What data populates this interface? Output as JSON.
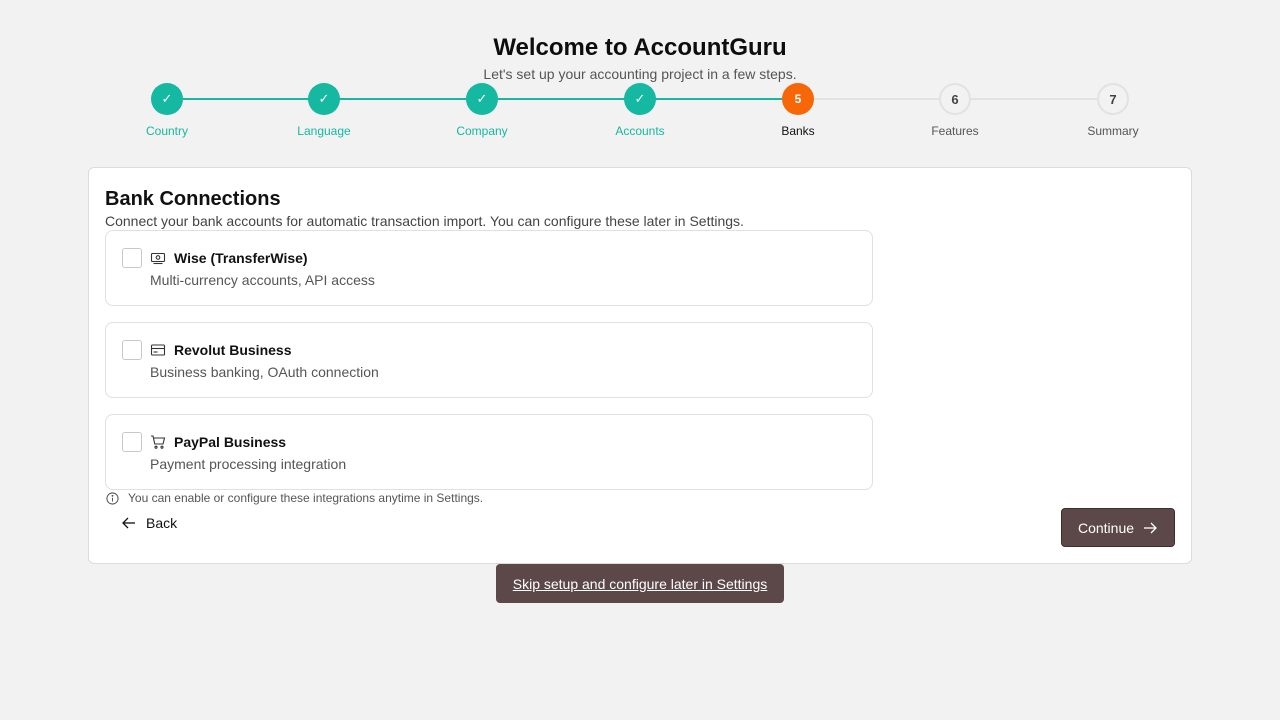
{
  "header": {
    "title": "Welcome to AccountGuru",
    "subtitle": "Let's set up your accounting project in a few steps."
  },
  "steps": [
    {
      "label": "Country",
      "status": "done",
      "marker": "✓"
    },
    {
      "label": "Language",
      "status": "done",
      "marker": "✓"
    },
    {
      "label": "Company",
      "status": "done",
      "marker": "✓"
    },
    {
      "label": "Accounts",
      "status": "done",
      "marker": "✓"
    },
    {
      "label": "Banks",
      "status": "active",
      "marker": "5"
    },
    {
      "label": "Features",
      "status": "todo",
      "marker": "6"
    },
    {
      "label": "Summary",
      "status": "todo",
      "marker": "7"
    }
  ],
  "card": {
    "title": "Bank Connections",
    "description": "Connect your bank accounts for automatic transaction import. You can configure these later in Settings.",
    "banks": [
      {
        "name": "Wise (TransferWise)",
        "description": "Multi-currency accounts, API access",
        "icon": "banknote-icon",
        "checked": false
      },
      {
        "name": "Revolut Business",
        "description": "Business banking, OAuth connection",
        "icon": "credit-card-icon",
        "checked": false
      },
      {
        "name": "PayPal Business",
        "description": "Payment processing integration",
        "icon": "shopping-cart-icon",
        "checked": false
      }
    ],
    "note": "You can enable or configure these integrations anytime in Settings.",
    "back_label": "Back",
    "continue_label": "Continue"
  },
  "skip_label": "Skip setup and configure later in Settings",
  "colors": {
    "accent_done": "#15b8a1",
    "accent_active": "#f76707",
    "button": "#5c4848"
  }
}
